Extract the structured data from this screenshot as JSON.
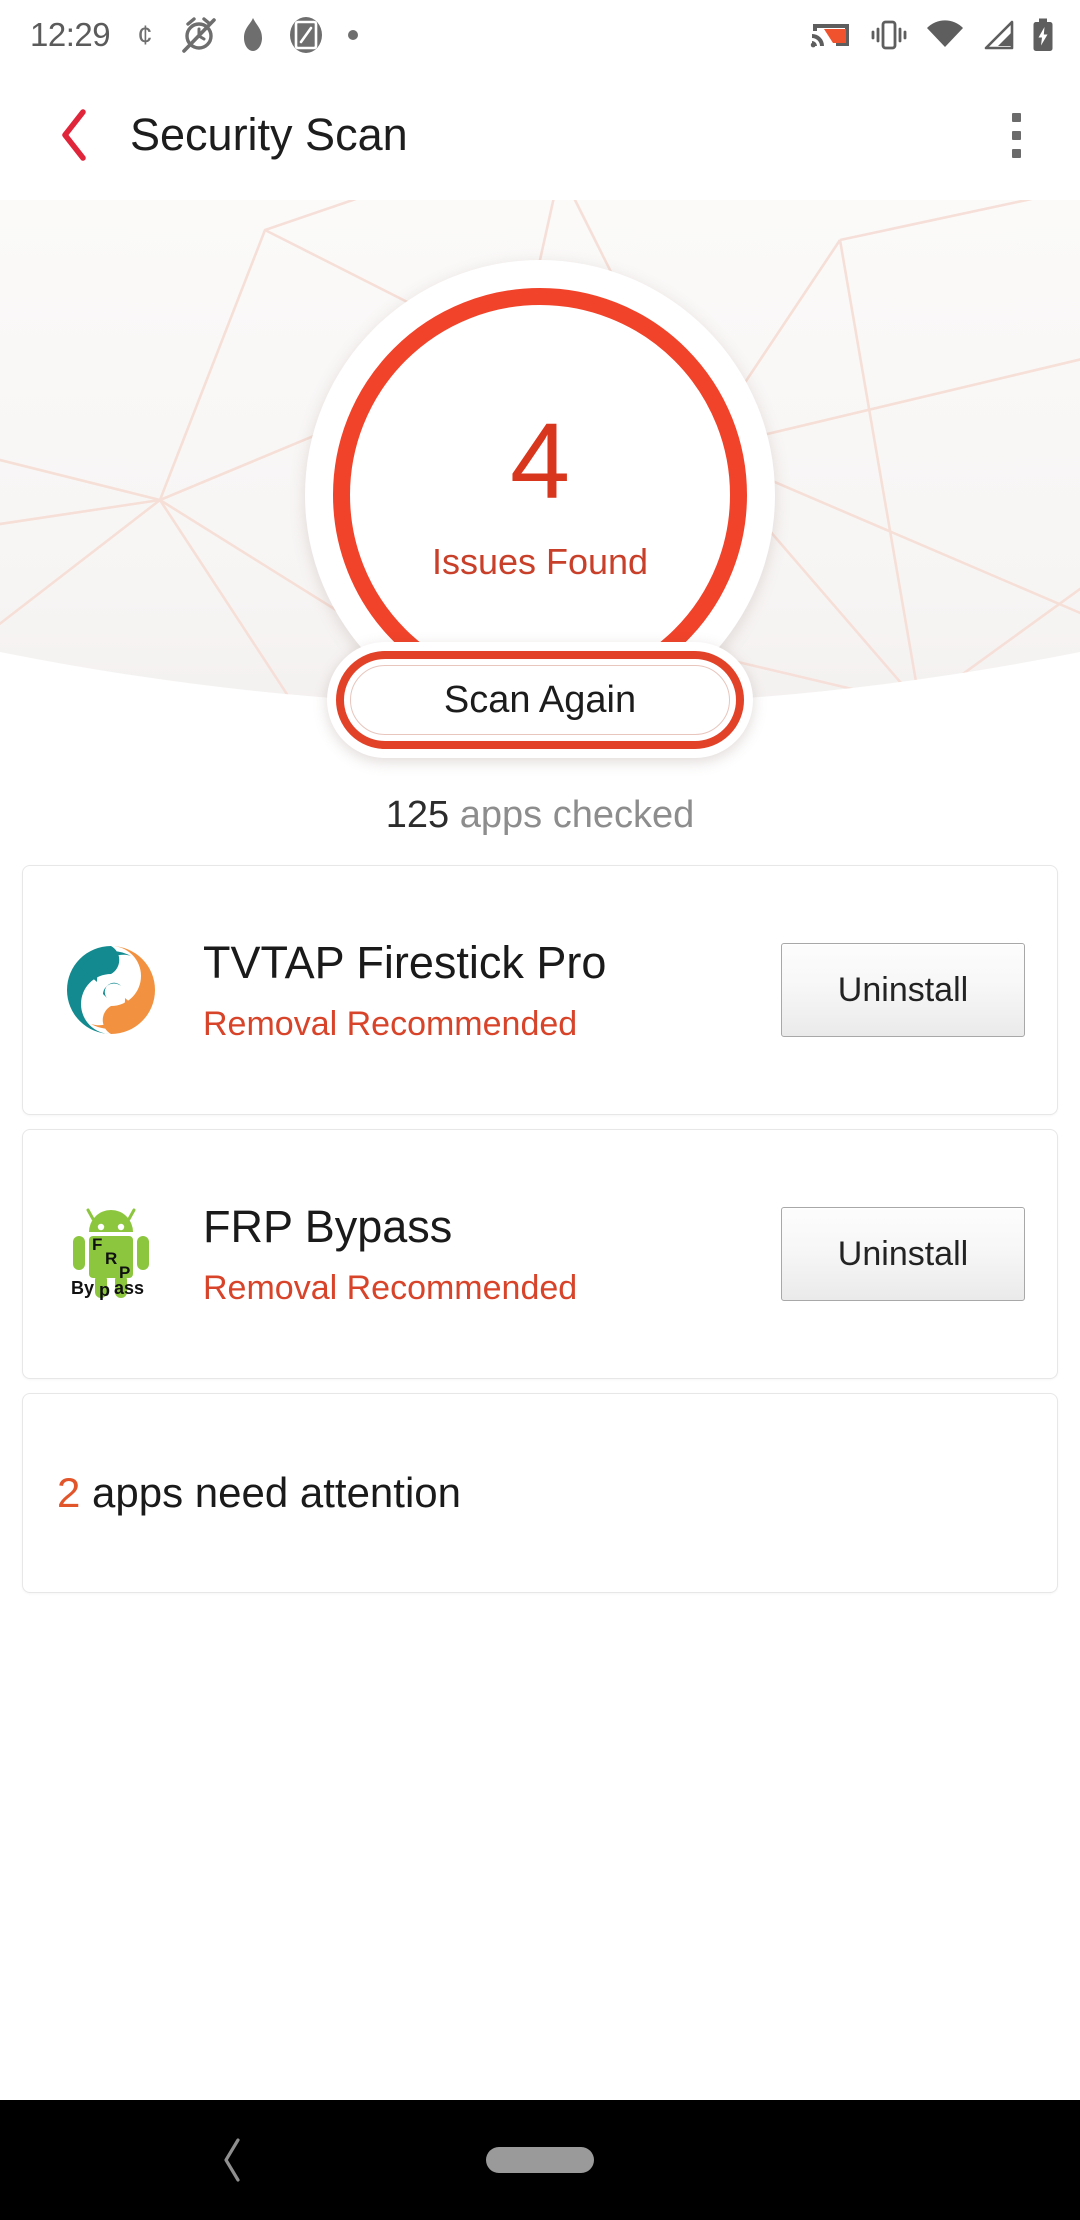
{
  "status_bar": {
    "time": "12:29",
    "left_icons": [
      "currency-cent-icon",
      "alarm-off-icon",
      "flame-icon",
      "screenshot-icon",
      "dot-icon"
    ],
    "right_icons": [
      "cast-icon",
      "vibrate-icon",
      "wifi-icon",
      "cellular-signal-icon",
      "battery-charging-icon"
    ]
  },
  "app_bar": {
    "back_icon": "back-chevron-icon",
    "title": "Security Scan",
    "overflow_icon": "overflow-menu-icon"
  },
  "hero": {
    "issues_count": "4",
    "issues_label": "Issues Found",
    "scan_button_label": "Scan Again"
  },
  "summary": {
    "checked_count": "125",
    "checked_text": " apps checked"
  },
  "apps": [
    {
      "icon": "tvtap-swirl-icon",
      "name": "TVTAP Firestick Pro",
      "status": "Removal Recommended",
      "action_label": "Uninstall"
    },
    {
      "icon": "frp-bypass-android-icon",
      "name": "FRP Bypass",
      "status": "Removal Recommended",
      "action_label": "Uninstall"
    }
  ],
  "attention": {
    "count": "2",
    "text": " apps need attention"
  },
  "nav_bar": {
    "back_icon": "nav-back-icon",
    "home_icon": "nav-home-handle"
  },
  "colors": {
    "accent_ring": "#f0432a",
    "accent_text": "#d8361d",
    "status_red": "#d8442a",
    "attention_orange": "#e2552a",
    "title_text": "#1d1d1d",
    "muted_text": "#8d8d8d",
    "back_chevron": "#e0243a",
    "hero_line": "#f6ded6",
    "nav_bg": "#000000"
  }
}
